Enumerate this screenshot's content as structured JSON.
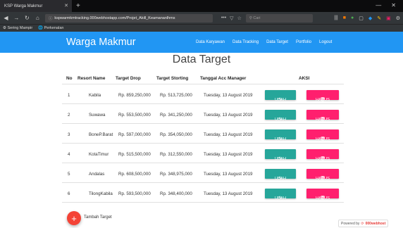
{
  "browser": {
    "tab_title": "KSP Warga Makmur",
    "url_prefix": "ⓘ",
    "url": "kspwarmkmtracking.000webhostapp.com/Projet_Akill_Keamananlhms",
    "search_placeholder": "Cari",
    "bookmarks": [
      "Sering Mampir",
      "Perkenalan"
    ]
  },
  "navbar": {
    "brand": "Warga Makmur",
    "links": [
      "Data Karyawan",
      "Data Tracking",
      "Data Target",
      "Portfolio",
      "Logout"
    ]
  },
  "page": {
    "title": "Data Target",
    "columns": [
      "No",
      "Resort Name",
      "Target Drop",
      "Target Storting",
      "Tanggal Acc Manager",
      "AKSI"
    ],
    "rows": [
      {
        "no": "1",
        "resort": "Kabila",
        "drop": "Rp. 859,250,000",
        "storting": "Rp. 513,725,000",
        "tanggal": "Tuesday, 13 August 2019"
      },
      {
        "no": "2",
        "resort": "Suwawa",
        "drop": "Rp. 553,500,000",
        "storting": "Rp. 341,250,000",
        "tanggal": "Tuesday, 13 August 2019"
      },
      {
        "no": "3",
        "resort": "BoneP.Barat",
        "drop": "Rp. 597,000,000",
        "storting": "Rp. 354,050,000",
        "tanggal": "Tuesday, 13 August 2019"
      },
      {
        "no": "4",
        "resort": "KotaTimur",
        "drop": "Rp. 515,500,000",
        "storting": "Rp. 312,550,000",
        "tanggal": "Tuesday, 13 August 2019"
      },
      {
        "no": "5",
        "resort": "Andalas",
        "drop": "Rp. 608,500,000",
        "storting": "Rp. 348,975,000",
        "tanggal": "Tuesday, 13 August 2019"
      },
      {
        "no": "6",
        "resort": "TilongKabila",
        "drop": "Rp. 593,500,000",
        "storting": "Rp. 348,400,000",
        "tanggal": "Tuesday, 13 August 2019"
      }
    ],
    "edit_label": "UBAH",
    "delete_label": "HAPUS",
    "add_label": "Tambah Target",
    "add_icon": "+",
    "powered_prefix": "Powered by",
    "powered_brand": "000webhost"
  },
  "colors": {
    "navbar": "#2196f3",
    "edit": "#26a69a",
    "delete": "#ff1f6e",
    "fab": "#f44336"
  }
}
